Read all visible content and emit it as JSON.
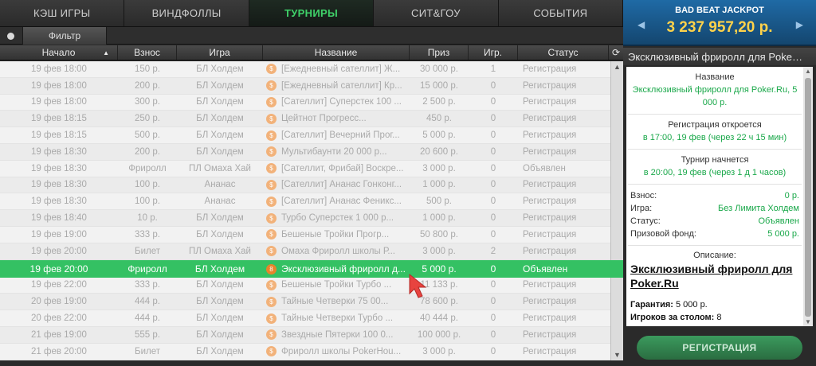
{
  "tabs": [
    {
      "label": "КЭШ ИГРЫ"
    },
    {
      "label": "ВИНДФОЛЛЫ"
    },
    {
      "label": "ТУРНИРЫ",
      "active": true
    },
    {
      "label": "СИТ&ГОУ"
    },
    {
      "label": "СОБЫТИЯ"
    }
  ],
  "filter": {
    "label": "Фильтр"
  },
  "columns": [
    "Начало",
    "Взнос",
    "Игра",
    "Название",
    "Приз",
    "Игр.",
    "Статус"
  ],
  "rows": [
    {
      "start": "19 фев 18:00",
      "fee": "150 р.",
      "game": "БЛ Холдем",
      "name": "[Ежедневный сателлит] Ж...",
      "prize": "30 000 р.",
      "players": "1",
      "status": "Регистрация"
    },
    {
      "start": "19 фев 18:00",
      "fee": "200 р.",
      "game": "БЛ Холдем",
      "name": "[Ежедневный сателлит] Кр...",
      "prize": "15 000 р.",
      "players": "0",
      "status": "Регистрация"
    },
    {
      "start": "19 фев 18:00",
      "fee": "300 р.",
      "game": "БЛ Холдем",
      "name": "[Сателлит] Суперстек 100 ...",
      "prize": "2 500 р.",
      "players": "0",
      "status": "Регистрация"
    },
    {
      "start": "19 фев 18:15",
      "fee": "250 р.",
      "game": "БЛ Холдем",
      "name": "Цейтнот Прогресс...",
      "prize": "450 р.",
      "players": "0",
      "status": "Регистрация"
    },
    {
      "start": "19 фев 18:15",
      "fee": "500 р.",
      "game": "БЛ Холдем",
      "name": "[Сателлит] Вечерний Прог...",
      "prize": "5 000 р.",
      "players": "0",
      "status": "Регистрация"
    },
    {
      "start": "19 фев 18:30",
      "fee": "200 р.",
      "game": "БЛ Холдем",
      "name": "Мультибаунти 20 000 р...",
      "prize": "20 600 р.",
      "players": "0",
      "status": "Регистрация"
    },
    {
      "start": "19 фев 18:30",
      "fee": "Фриролл",
      "game": "ПЛ Омаха Хай",
      "name": "[Сателлит, Фрибай] Воскре...",
      "prize": "3 000 р.",
      "players": "0",
      "status": "Объявлен"
    },
    {
      "start": "19 фев 18:30",
      "fee": "100 р.",
      "game": "Ананас",
      "name": "[Сателлит] Ананас Гонконг...",
      "prize": "1 000 р.",
      "players": "0",
      "status": "Регистрация"
    },
    {
      "start": "19 фев 18:30",
      "fee": "100 р.",
      "game": "Ананас",
      "name": "[Сателлит] Ананас Феникс...",
      "prize": "500 р.",
      "players": "0",
      "status": "Регистрация"
    },
    {
      "start": "19 фев 18:40",
      "fee": "10 р.",
      "game": "БЛ Холдем",
      "name": "Турбо Суперстек 1 000 р...",
      "prize": "1 000 р.",
      "players": "0",
      "status": "Регистрация"
    },
    {
      "start": "19 фев 19:00",
      "fee": "333 р.",
      "game": "БЛ Холдем",
      "name": "Бешеные Тройки Прогр...",
      "prize": "50 800 р.",
      "players": "0",
      "status": "Регистрация"
    },
    {
      "start": "19 фев 20:00",
      "fee": "Билет",
      "game": "ПЛ Омаха Хай",
      "name": "Омаха Фриролл школы Р...",
      "prize": "3 000 р.",
      "players": "2",
      "status": "Регистрация"
    }
  ],
  "selected_row": {
    "start": "19 фев 20:00",
    "fee": "Фриролл",
    "game": "БЛ Холдем",
    "name": "Эксклюзивный фриролл д...",
    "prize": "5 000 р.",
    "players": "0",
    "status": "Объявлен",
    "badge": "8"
  },
  "rows_after": [
    {
      "start": "19 фев 22:00",
      "fee": "333 р.",
      "game": "БЛ Холдем",
      "name": "Бешеные Тройки Турбо ...",
      "prize": "11 133 р.",
      "players": "0",
      "status": "Регистрация"
    },
    {
      "start": "20 фев 19:00",
      "fee": "444 р.",
      "game": "БЛ Холдем",
      "name": "Тайные Четверки 75 00...",
      "prize": "78 600 р.",
      "players": "0",
      "status": "Регистрация"
    },
    {
      "start": "20 фев 22:00",
      "fee": "444 р.",
      "game": "БЛ Холдем",
      "name": "Тайные Четверки Турбо ...",
      "prize": "40 444 р.",
      "players": "0",
      "status": "Регистрация"
    },
    {
      "start": "21 фев 19:00",
      "fee": "555 р.",
      "game": "БЛ Холдем",
      "name": "Звездные Пятерки 100 0...",
      "prize": "100 000 р.",
      "players": "0",
      "status": "Регистрация"
    },
    {
      "start": "21 фев 20:00",
      "fee": "Билет",
      "game": "БЛ Холдем",
      "name": "Фриролл школы PokerHou...",
      "prize": "3 000 р.",
      "players": "0",
      "status": "Регистрация"
    }
  ],
  "jackpot": {
    "title": "BAD BEAT JACKPOT",
    "amount": "3 237 957,20 р."
  },
  "detail": {
    "header": "Эксклюзивный фриролл для Poker...",
    "name_label": "Название",
    "name_value": "Эксклюзивный фриролл для Poker.Ru, 5 000 р.",
    "reg_label": "Регистрация откроется",
    "reg_value": "в 17:00, 19 фев (через 22 ч 15 мин)",
    "start_label": "Турнир начнется",
    "start_value": "в 20:00, 19 фев (через 1 д 1 часов)",
    "fee_k": "Взнос:",
    "fee_v": "0 р.",
    "game_k": "Игра:",
    "game_v": "Без Лимита Холдем",
    "status_k": "Статус:",
    "status_v": "Объявлен",
    "prize_k": "Призовой фонд:",
    "prize_v": "5 000 р.",
    "desc_label": "Описание:",
    "desc_title": "Эксклюзивный фриролл для Poker.Ru",
    "guarantee_k": "Гарантия:",
    "guarantee_v": "5 000 р.",
    "table_k": "Игроков за столом:",
    "table_v": "8"
  },
  "register_button": "РЕГИСТРАЦИЯ"
}
